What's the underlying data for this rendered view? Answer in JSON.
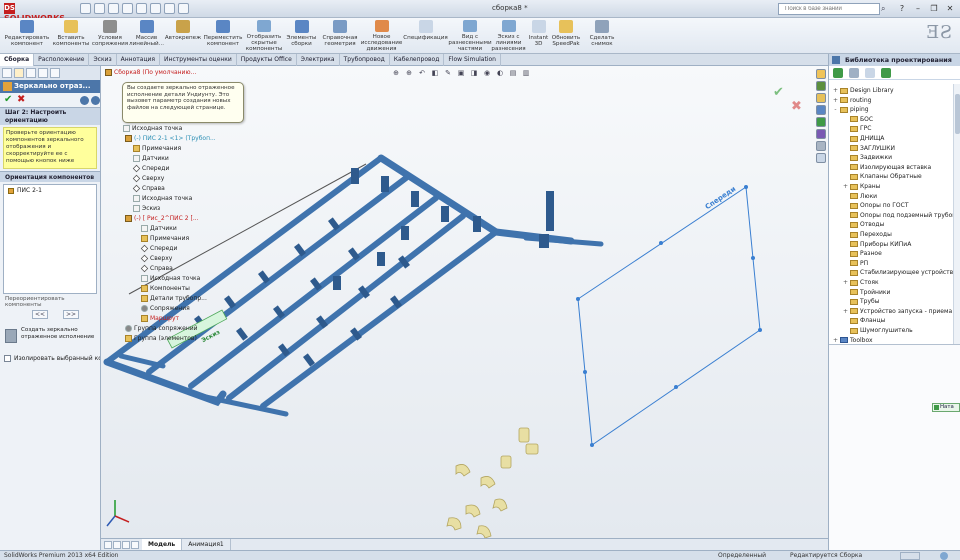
{
  "title_bar": {
    "app_logo": "SOLIDWORKS",
    "document_title": "сборка8 *",
    "search_placeholder": "Поиск в базе знаний"
  },
  "ribbon": {
    "buttons": [
      {
        "label": "Редактировать компонент",
        "icon": "edit-component-icon"
      },
      {
        "label": "Вставить компоненты",
        "icon": "insert-components-icon"
      },
      {
        "label": "Условия сопряжения",
        "icon": "mate-icon"
      },
      {
        "label": "Массив линейный...",
        "icon": "linear-pattern-icon"
      },
      {
        "label": "Автокрепеж",
        "icon": "smart-fasteners-icon"
      },
      {
        "label": "Переместить компонент",
        "icon": "move-component-icon"
      },
      {
        "label": "Отобразить скрытые компоненты",
        "icon": "show-hidden-icon"
      },
      {
        "label": "Элементы сборки",
        "icon": "assembly-features-icon"
      },
      {
        "label": "Справочная геометрия",
        "icon": "reference-geometry-icon"
      },
      {
        "label": "Новое исследование движения",
        "icon": "new-motion-study-icon"
      },
      {
        "label": "Спецификация",
        "icon": "bom-icon"
      },
      {
        "label": "Вид с разнесенными частями",
        "icon": "exploded-view-icon"
      },
      {
        "label": "Эскиз с линиями разнесения",
        "icon": "explode-line-sketch-icon"
      },
      {
        "label": "Instant 3D",
        "icon": "instant3d-icon"
      },
      {
        "label": "Обновить SpeedPak",
        "icon": "speedpak-icon"
      },
      {
        "label": "Сделать снимок",
        "icon": "snapshot-icon"
      }
    ]
  },
  "command_tabs": [
    "Сборка",
    "Расположение",
    "Эскиз",
    "Аннотация",
    "Инструменты оценки",
    "Продукты Office",
    "Электрика",
    "Трубопровод",
    "Кабелепровод",
    "Flow Simulation"
  ],
  "property_manager": {
    "title": "Зеркально отраз...",
    "step_header": "Шаг 2: Настроить ориентацию",
    "message": "Проверьте ориентацию компонентов зеркального отображения и скорректируйте ее с помощью кнопок ниже",
    "orientation_header": "Ориентация компонентов",
    "component_item": "ПИС 2-1",
    "reorient_label": "Переориентировать компоненты",
    "mirror_button_label": "Создать зеркально отраженное исполнение",
    "isolate_label": "Изолировать выбранный компонент"
  },
  "feature_tree": {
    "root": "Сборка8 (По умолчанию...",
    "tooltip": "Вы создаете зеркально отраженное исполнение детали Ундиунту. Это вызовет параметр создания новых файлов на следующей странице.",
    "items": [
      {
        "label": "Исходная точка",
        "icon": "origin-icon",
        "style": "plain"
      },
      {
        "label": "(-) ПИС 2-1 <1> (Трубоп...",
        "icon": "assembly-icon",
        "style": "teal"
      },
      {
        "label": "Примечания",
        "icon": "folder-icon",
        "style": "plain"
      },
      {
        "label": "Датчики",
        "icon": "sensor-icon",
        "style": "plain"
      },
      {
        "label": "Спереди",
        "icon": "plane-icon",
        "style": "plain"
      },
      {
        "label": "Сверху",
        "icon": "plane-icon",
        "style": "plain"
      },
      {
        "label": "Справа",
        "icon": "plane-icon",
        "style": "plain"
      },
      {
        "label": "Исходная точка",
        "icon": "origin-icon",
        "style": "plain"
      },
      {
        "label": "Эскиз",
        "icon": "sketch-icon",
        "style": "plain"
      },
      {
        "label": "(-) [ Рис_2^ПИС 2 [...",
        "icon": "assembly-icon",
        "style": "red"
      },
      {
        "label": "Датчики",
        "icon": "sensor-icon",
        "style": "plain"
      },
      {
        "label": "Примечания",
        "icon": "folder-icon",
        "style": "plain"
      },
      {
        "label": "Спереди",
        "icon": "plane-icon",
        "style": "plain"
      },
      {
        "label": "Сверху",
        "icon": "plane-icon",
        "style": "plain"
      },
      {
        "label": "Справа",
        "icon": "plane-icon",
        "style": "plain"
      },
      {
        "label": "Исходная точка",
        "icon": "origin-icon",
        "style": "plain"
      },
      {
        "label": "Компоненты",
        "icon": "folder-icon",
        "style": "plain"
      },
      {
        "label": "Детали трубопр...",
        "icon": "folder-icon",
        "style": "plain"
      },
      {
        "label": "Сопряжения",
        "icon": "mate-icon",
        "style": "plain"
      },
      {
        "label": "Маршрут",
        "icon": "route-icon",
        "style": "red"
      },
      {
        "label": "Группа сопряжений",
        "icon": "mate-group-icon",
        "style": "plain"
      },
      {
        "label": "Группа (элементов)",
        "icon": "folder-icon",
        "style": "plain"
      }
    ]
  },
  "viewport": {
    "plane_label": "Спереди",
    "tag_label": "Эскиз"
  },
  "bottom_tabs": [
    "Модель",
    "Анимация1"
  ],
  "status_bar": {
    "product": "SolidWorks Premium 2013 x64 Edition",
    "state1": "Определенный",
    "state2": "Редактируется Сборка"
  },
  "design_library": {
    "title": "Библиотека проектирования",
    "items": [
      {
        "label": "Design Library",
        "level": 0,
        "toggle": "+",
        "icon": "folder"
      },
      {
        "label": "routing",
        "level": 0,
        "toggle": "+",
        "icon": "folder"
      },
      {
        "label": "piping",
        "level": 0,
        "toggle": "-",
        "icon": "folder"
      },
      {
        "label": "БОС",
        "level": 1,
        "toggle": "",
        "icon": "folder"
      },
      {
        "label": "ГРС",
        "level": 1,
        "toggle": "",
        "icon": "folder"
      },
      {
        "label": "ДНИЩА",
        "level": 1,
        "toggle": "",
        "icon": "folder"
      },
      {
        "label": "ЗАГЛУШКИ",
        "level": 1,
        "toggle": "",
        "icon": "folder"
      },
      {
        "label": "Задвижки",
        "level": 1,
        "toggle": "",
        "icon": "folder"
      },
      {
        "label": "Изолирующая вставка",
        "level": 1,
        "toggle": "",
        "icon": "folder"
      },
      {
        "label": "Клапаны Обратные",
        "level": 1,
        "toggle": "",
        "icon": "folder"
      },
      {
        "label": "Краны",
        "level": 1,
        "toggle": "+",
        "icon": "folder"
      },
      {
        "label": "Люки",
        "level": 1,
        "toggle": "",
        "icon": "folder"
      },
      {
        "label": "Опоры по ГОСТ",
        "level": 1,
        "toggle": "",
        "icon": "folder"
      },
      {
        "label": "Опоры под подземный трубопр",
        "level": 1,
        "toggle": "",
        "icon": "folder"
      },
      {
        "label": "Отводы",
        "level": 1,
        "toggle": "",
        "icon": "folder"
      },
      {
        "label": "Переходы",
        "level": 1,
        "toggle": "",
        "icon": "folder"
      },
      {
        "label": "Приборы КИПиА",
        "level": 1,
        "toggle": "",
        "icon": "folder"
      },
      {
        "label": "Разное",
        "level": 1,
        "toggle": "",
        "icon": "folder"
      },
      {
        "label": "РП",
        "level": 1,
        "toggle": "",
        "icon": "folder"
      },
      {
        "label": "Стабилизирующее устройство",
        "level": 1,
        "toggle": "",
        "icon": "folder"
      },
      {
        "label": "Стояк",
        "level": 1,
        "toggle": "+",
        "icon": "folder"
      },
      {
        "label": "Тройники",
        "level": 1,
        "toggle": "",
        "icon": "folder"
      },
      {
        "label": "Трубы",
        "level": 1,
        "toggle": "",
        "icon": "folder"
      },
      {
        "label": "Устройство запуска - приема",
        "level": 1,
        "toggle": "+",
        "icon": "folder"
      },
      {
        "label": "Фланцы",
        "level": 1,
        "toggle": "",
        "icon": "folder"
      },
      {
        "label": "Шумоглушитель",
        "level": 1,
        "toggle": "",
        "icon": "folder"
      },
      {
        "label": "Toolbox",
        "level": 0,
        "toggle": "+",
        "icon": "blue"
      }
    ]
  },
  "mini_tag": "Ната",
  "colors": {
    "accent": "#4c76a9",
    "pipe": "#3f73ad",
    "plane_outline": "#3a7fd1",
    "ok": "#1f9a2a",
    "cancel": "#c41e1e",
    "tree_folder": "#e7c15a"
  }
}
